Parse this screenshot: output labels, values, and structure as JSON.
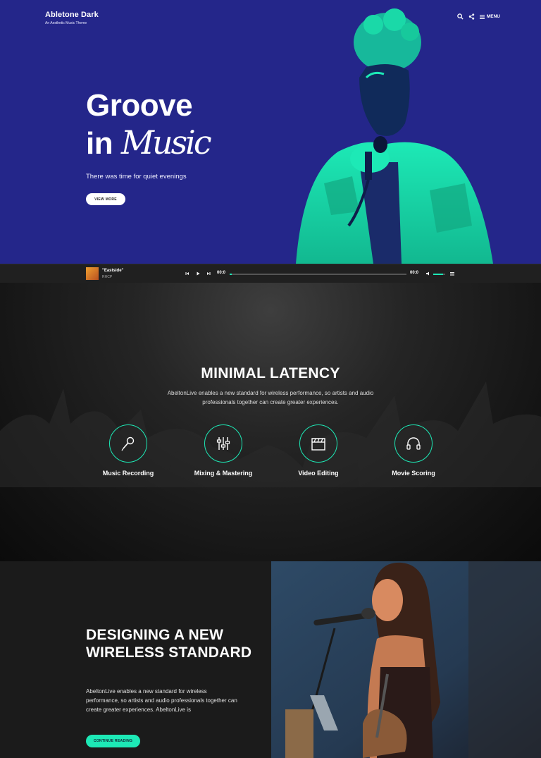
{
  "site": {
    "title": "Abletone Dark",
    "tagline": "An Aesthetic Music Theme",
    "menu_label": "MENU",
    "search_icon": "search-icon",
    "share_icon": "share-icon",
    "menu_icon": "hamburger-icon"
  },
  "hero": {
    "heading_line1": "Groove",
    "heading_line2_word1": "in",
    "heading_line2_word2": "Music",
    "subtitle": "There was time for quiet evenings",
    "button_label": "VIEW MORE",
    "background_color": "#24268a",
    "accent_color": "#1de9b6"
  },
  "player": {
    "track_title": "\"Eastside\"",
    "artist": "RHCP",
    "current_time": "00:0",
    "duration": "00:0",
    "progress": 0.01,
    "volume": 0.8,
    "icons": [
      "prev-icon",
      "play-icon",
      "next-icon",
      "volume-icon",
      "playlist-icon"
    ]
  },
  "latency": {
    "title": "MINIMAL LATENCY",
    "description": "AbeltonLive enables a new standard for wireless performance, so artists and audio professionals together can create greater experiences.",
    "services": [
      {
        "label": "Music Recording",
        "icon": "microphone-icon"
      },
      {
        "label": "Mixing & Mastering",
        "icon": "sliders-icon"
      },
      {
        "label": "Video Editing",
        "icon": "clapperboard-icon"
      },
      {
        "label": "Movie Scoring",
        "icon": "headphones-icon"
      }
    ]
  },
  "design": {
    "title": "DESIGNING A NEW WIRELESS STANDARD",
    "description": "AbeltonLive enables a new standard for wireless performance, so artists and audio professionals together can create greater experiences. AbeltonLive is",
    "button_label": "CONTINUE READING"
  }
}
